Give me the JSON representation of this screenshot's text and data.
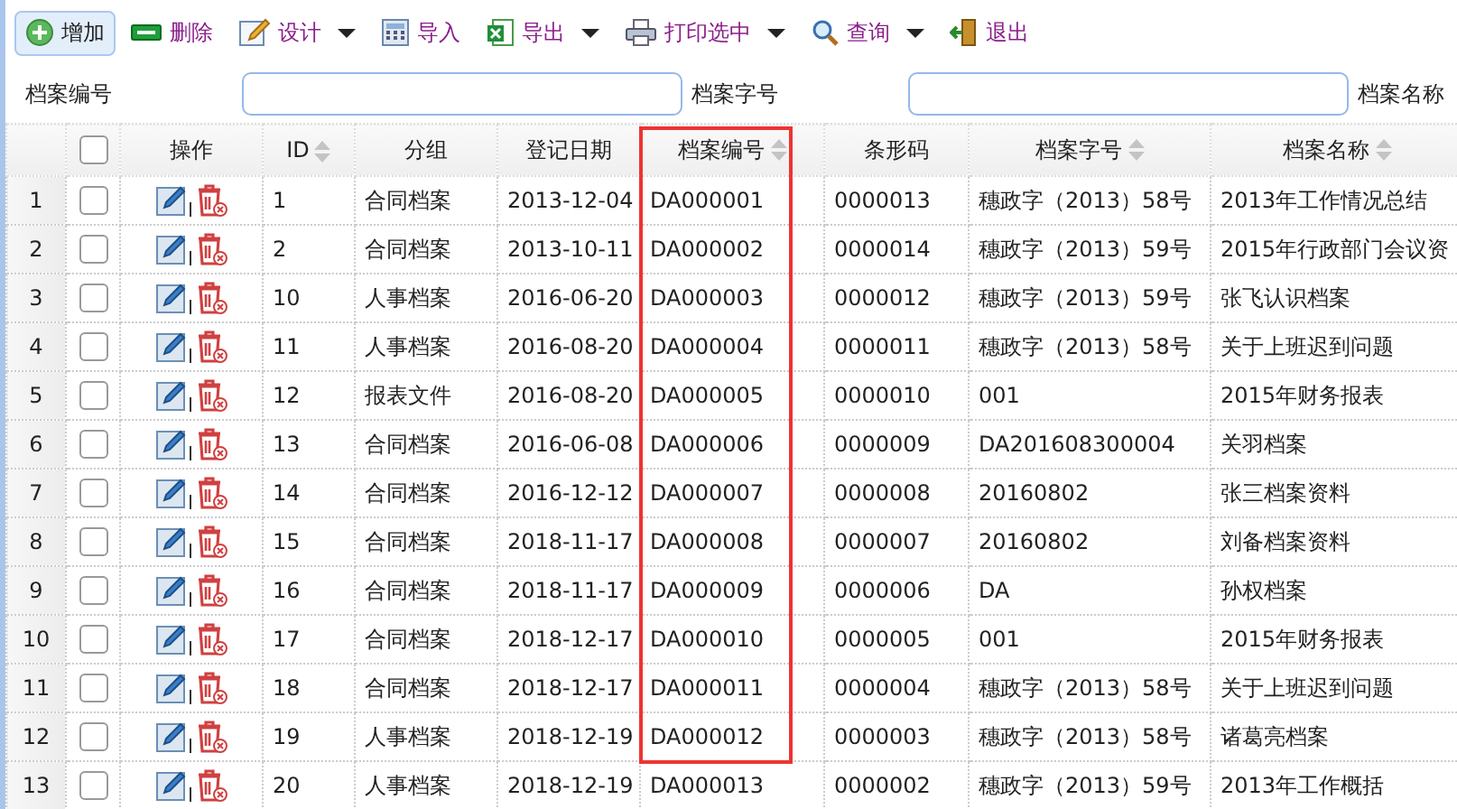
{
  "toolbar": [
    {
      "label": "增加",
      "kind": "add",
      "dropdown": false,
      "active": true
    },
    {
      "label": "删除",
      "kind": "delete",
      "dropdown": false,
      "active": false
    },
    {
      "label": "设计",
      "kind": "design",
      "dropdown": true,
      "active": false
    },
    {
      "label": "导入",
      "kind": "import",
      "dropdown": false,
      "active": false
    },
    {
      "label": "导出",
      "kind": "export",
      "dropdown": true,
      "active": false
    },
    {
      "label": "打印选中",
      "kind": "print",
      "dropdown": true,
      "active": false
    },
    {
      "label": "查询",
      "kind": "search",
      "dropdown": true,
      "active": false
    },
    {
      "label": "退出",
      "kind": "exit",
      "dropdown": false,
      "active": false
    }
  ],
  "search_fields": [
    {
      "label": "档案编号"
    },
    {
      "label": "档案字号"
    },
    {
      "label": "档案名称"
    }
  ],
  "table": {
    "header_checked": false,
    "columns": [
      {
        "label": "操作",
        "sortable": false,
        "highlighted": false
      },
      {
        "label": "ID",
        "sortable": true,
        "highlighted": false
      },
      {
        "label": "分组",
        "sortable": false,
        "highlighted": false
      },
      {
        "label": "登记日期",
        "sortable": false,
        "highlighted": false
      },
      {
        "label": "档案编号",
        "sortable": true,
        "highlighted": true
      },
      {
        "label": "条形码",
        "sortable": false,
        "highlighted": false
      },
      {
        "label": "档案字号",
        "sortable": true,
        "highlighted": false
      },
      {
        "label": "档案名称",
        "sortable": true,
        "highlighted": false
      }
    ],
    "rows": [
      {
        "number": "1",
        "checked": false,
        "frame_end": false,
        "cells": [
          "",
          "1",
          "合同档案",
          "2013-12-04",
          "DA000001",
          "0000013",
          "穗政字（2013）58号",
          "2013年工作情况总结"
        ]
      },
      {
        "number": "2",
        "checked": false,
        "frame_end": false,
        "cells": [
          "",
          "2",
          "合同档案",
          "2013-10-11",
          "DA000002",
          "0000014",
          "穗政字（2013）59号",
          "2015年行政部门会议资"
        ]
      },
      {
        "number": "3",
        "checked": false,
        "frame_end": false,
        "cells": [
          "",
          "10",
          "人事档案",
          "2016-06-20",
          "DA000003",
          "0000012",
          "穗政字（2013）59号",
          "张飞认识档案"
        ]
      },
      {
        "number": "4",
        "checked": false,
        "frame_end": false,
        "cells": [
          "",
          "11",
          "人事档案",
          "2016-08-20",
          "DA000004",
          "0000011",
          "穗政字（2013）58号",
          "关于上班迟到问题"
        ]
      },
      {
        "number": "5",
        "checked": false,
        "frame_end": false,
        "cells": [
          "",
          "12",
          "报表文件",
          "2016-08-20",
          "DA000005",
          "0000010",
          "001",
          "2015年财务报表"
        ]
      },
      {
        "number": "6",
        "checked": false,
        "frame_end": false,
        "cells": [
          "",
          "13",
          "合同档案",
          "2016-06-08",
          "DA000006",
          "0000009",
          "DA201608300004",
          "关羽档案"
        ]
      },
      {
        "number": "7",
        "checked": false,
        "frame_end": false,
        "cells": [
          "",
          "14",
          "合同档案",
          "2016-12-12",
          "DA000007",
          "0000008",
          "20160802",
          "张三档案资料"
        ]
      },
      {
        "number": "8",
        "checked": false,
        "frame_end": false,
        "cells": [
          "",
          "15",
          "合同档案",
          "2018-11-17",
          "DA000008",
          "0000007",
          "20160802",
          "刘备档案资料"
        ]
      },
      {
        "number": "9",
        "checked": false,
        "frame_end": false,
        "cells": [
          "",
          "16",
          "合同档案",
          "2018-11-17",
          "DA000009",
          "0000006",
          "DA",
          "孙权档案"
        ]
      },
      {
        "number": "10",
        "checked": false,
        "frame_end": false,
        "cells": [
          "",
          "17",
          "合同档案",
          "2018-12-17",
          "DA000010",
          "0000005",
          "001",
          "2015年财务报表"
        ]
      },
      {
        "number": "11",
        "checked": false,
        "frame_end": false,
        "cells": [
          "",
          "18",
          "合同档案",
          "2018-12-17",
          "DA000011",
          "0000004",
          "穗政字（2013）58号",
          "关于上班迟到问题"
        ]
      },
      {
        "number": "12",
        "checked": false,
        "frame_end": true,
        "cells": [
          "",
          "19",
          "人事档案",
          "2018-12-19",
          "DA000012",
          "0000003",
          "穗政字（2013）58号",
          "诸葛亮档案"
        ]
      },
      {
        "number": "13",
        "checked": false,
        "frame_end": false,
        "cells": [
          "",
          "20",
          "人事档案",
          "2018-12-19",
          "DA000013",
          "0000002",
          "穗政字（2013）59号",
          "2013年工作概括"
        ]
      }
    ]
  }
}
